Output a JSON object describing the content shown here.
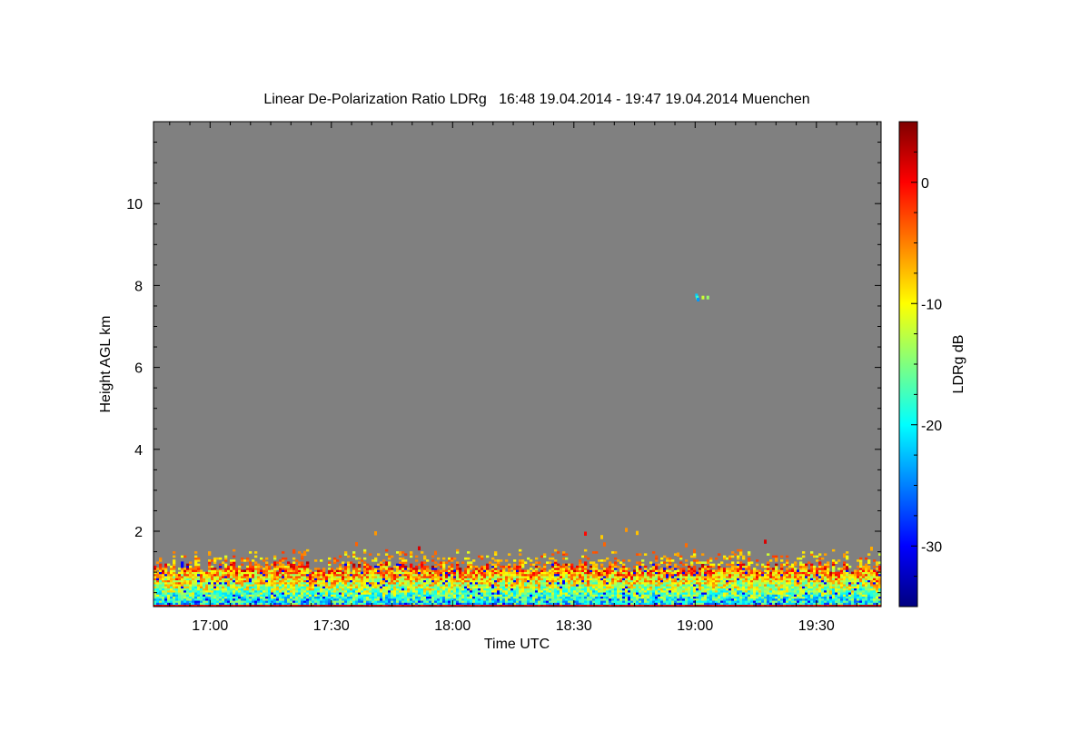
{
  "chart_data": {
    "type": "heatmap",
    "title": "Linear De-Polarization Ratio LDRg   16:48 19.04.2014 - 19:47 19.04.2014 Muenchen",
    "xlabel": "Time UTC",
    "ylabel": "Height AGL km",
    "colorbar_label": "LDRg dB",
    "xlim": [
      "16:46",
      "19:46"
    ],
    "ylim": [
      0.16,
      12
    ],
    "zlim": [
      -35,
      5
    ],
    "x_ticks": [
      "17:00",
      "17:30",
      "18:00",
      "18:30",
      "19:00",
      "19:30"
    ],
    "y_ticks": [
      2,
      4,
      6,
      8,
      10
    ],
    "colorbar_ticks": [
      0,
      -10,
      -20,
      -30
    ],
    "colormap": "jet",
    "background_color": "#808080",
    "layers": [
      {
        "feature": "boundary layer",
        "height_km": [
          0.16,
          1.1
        ],
        "ldr_db_typical": [
          -22,
          -3
        ]
      },
      {
        "feature": "isolated echo",
        "time": "19:00",
        "height_km": 7.7,
        "ldr_db_typical": -22
      }
    ]
  }
}
